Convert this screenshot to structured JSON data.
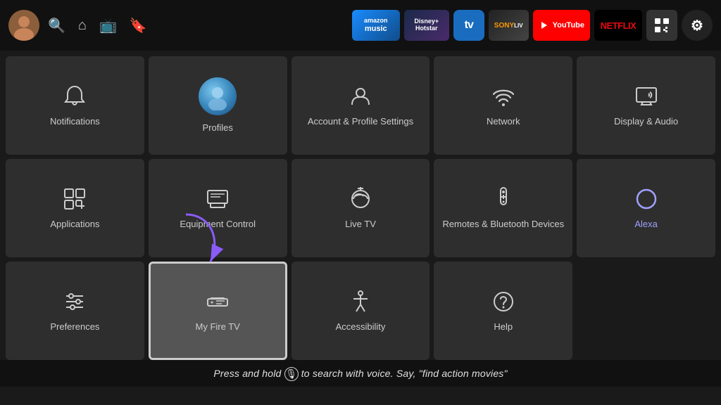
{
  "nav": {
    "apps": [
      {
        "id": "amazon-music",
        "label": "amazon music",
        "class": "app-amazon"
      },
      {
        "id": "disney-hotstar",
        "label": "disney+ hotstar",
        "class": "app-disney"
      },
      {
        "id": "tv",
        "label": "tv",
        "class": "app-tv"
      },
      {
        "id": "sony",
        "label": "SONY",
        "class": "app-sony"
      },
      {
        "id": "youtube",
        "label": "YouTube",
        "class": "app-youtube"
      },
      {
        "id": "netflix",
        "label": "NETFLIX",
        "class": "app-netflix"
      },
      {
        "id": "grid",
        "label": "⊞",
        "class": "app-grid"
      },
      {
        "id": "settings",
        "label": "⚙",
        "class": "app-settings"
      }
    ]
  },
  "grid": {
    "items": [
      {
        "id": "notifications",
        "label": "Notifications",
        "icon": "bell"
      },
      {
        "id": "profiles",
        "label": "Profiles",
        "icon": "profiles"
      },
      {
        "id": "account-profile",
        "label": "Account & Profile Settings",
        "icon": "person"
      },
      {
        "id": "network",
        "label": "Network",
        "icon": "wifi"
      },
      {
        "id": "display-audio",
        "label": "Display & Audio",
        "icon": "display"
      },
      {
        "id": "applications",
        "label": "Applications",
        "icon": "apps"
      },
      {
        "id": "equipment-control",
        "label": "Equipment Control",
        "icon": "equipment"
      },
      {
        "id": "live-tv",
        "label": "Live TV",
        "icon": "livetv"
      },
      {
        "id": "remotes-bluetooth",
        "label": "Remotes & Bluetooth Devices",
        "icon": "remote"
      },
      {
        "id": "alexa",
        "label": "Alexa",
        "icon": "alexa"
      },
      {
        "id": "preferences",
        "label": "Preferences",
        "icon": "prefs"
      },
      {
        "id": "my-fire-tv",
        "label": "My Fire TV",
        "icon": "firetv"
      },
      {
        "id": "accessibility",
        "label": "Accessibility",
        "icon": "access"
      },
      {
        "id": "help",
        "label": "Help",
        "icon": "help"
      }
    ]
  },
  "bottom_bar": {
    "text": "Press and hold 🎤 to search with voice. Say, \"find action movies\""
  }
}
